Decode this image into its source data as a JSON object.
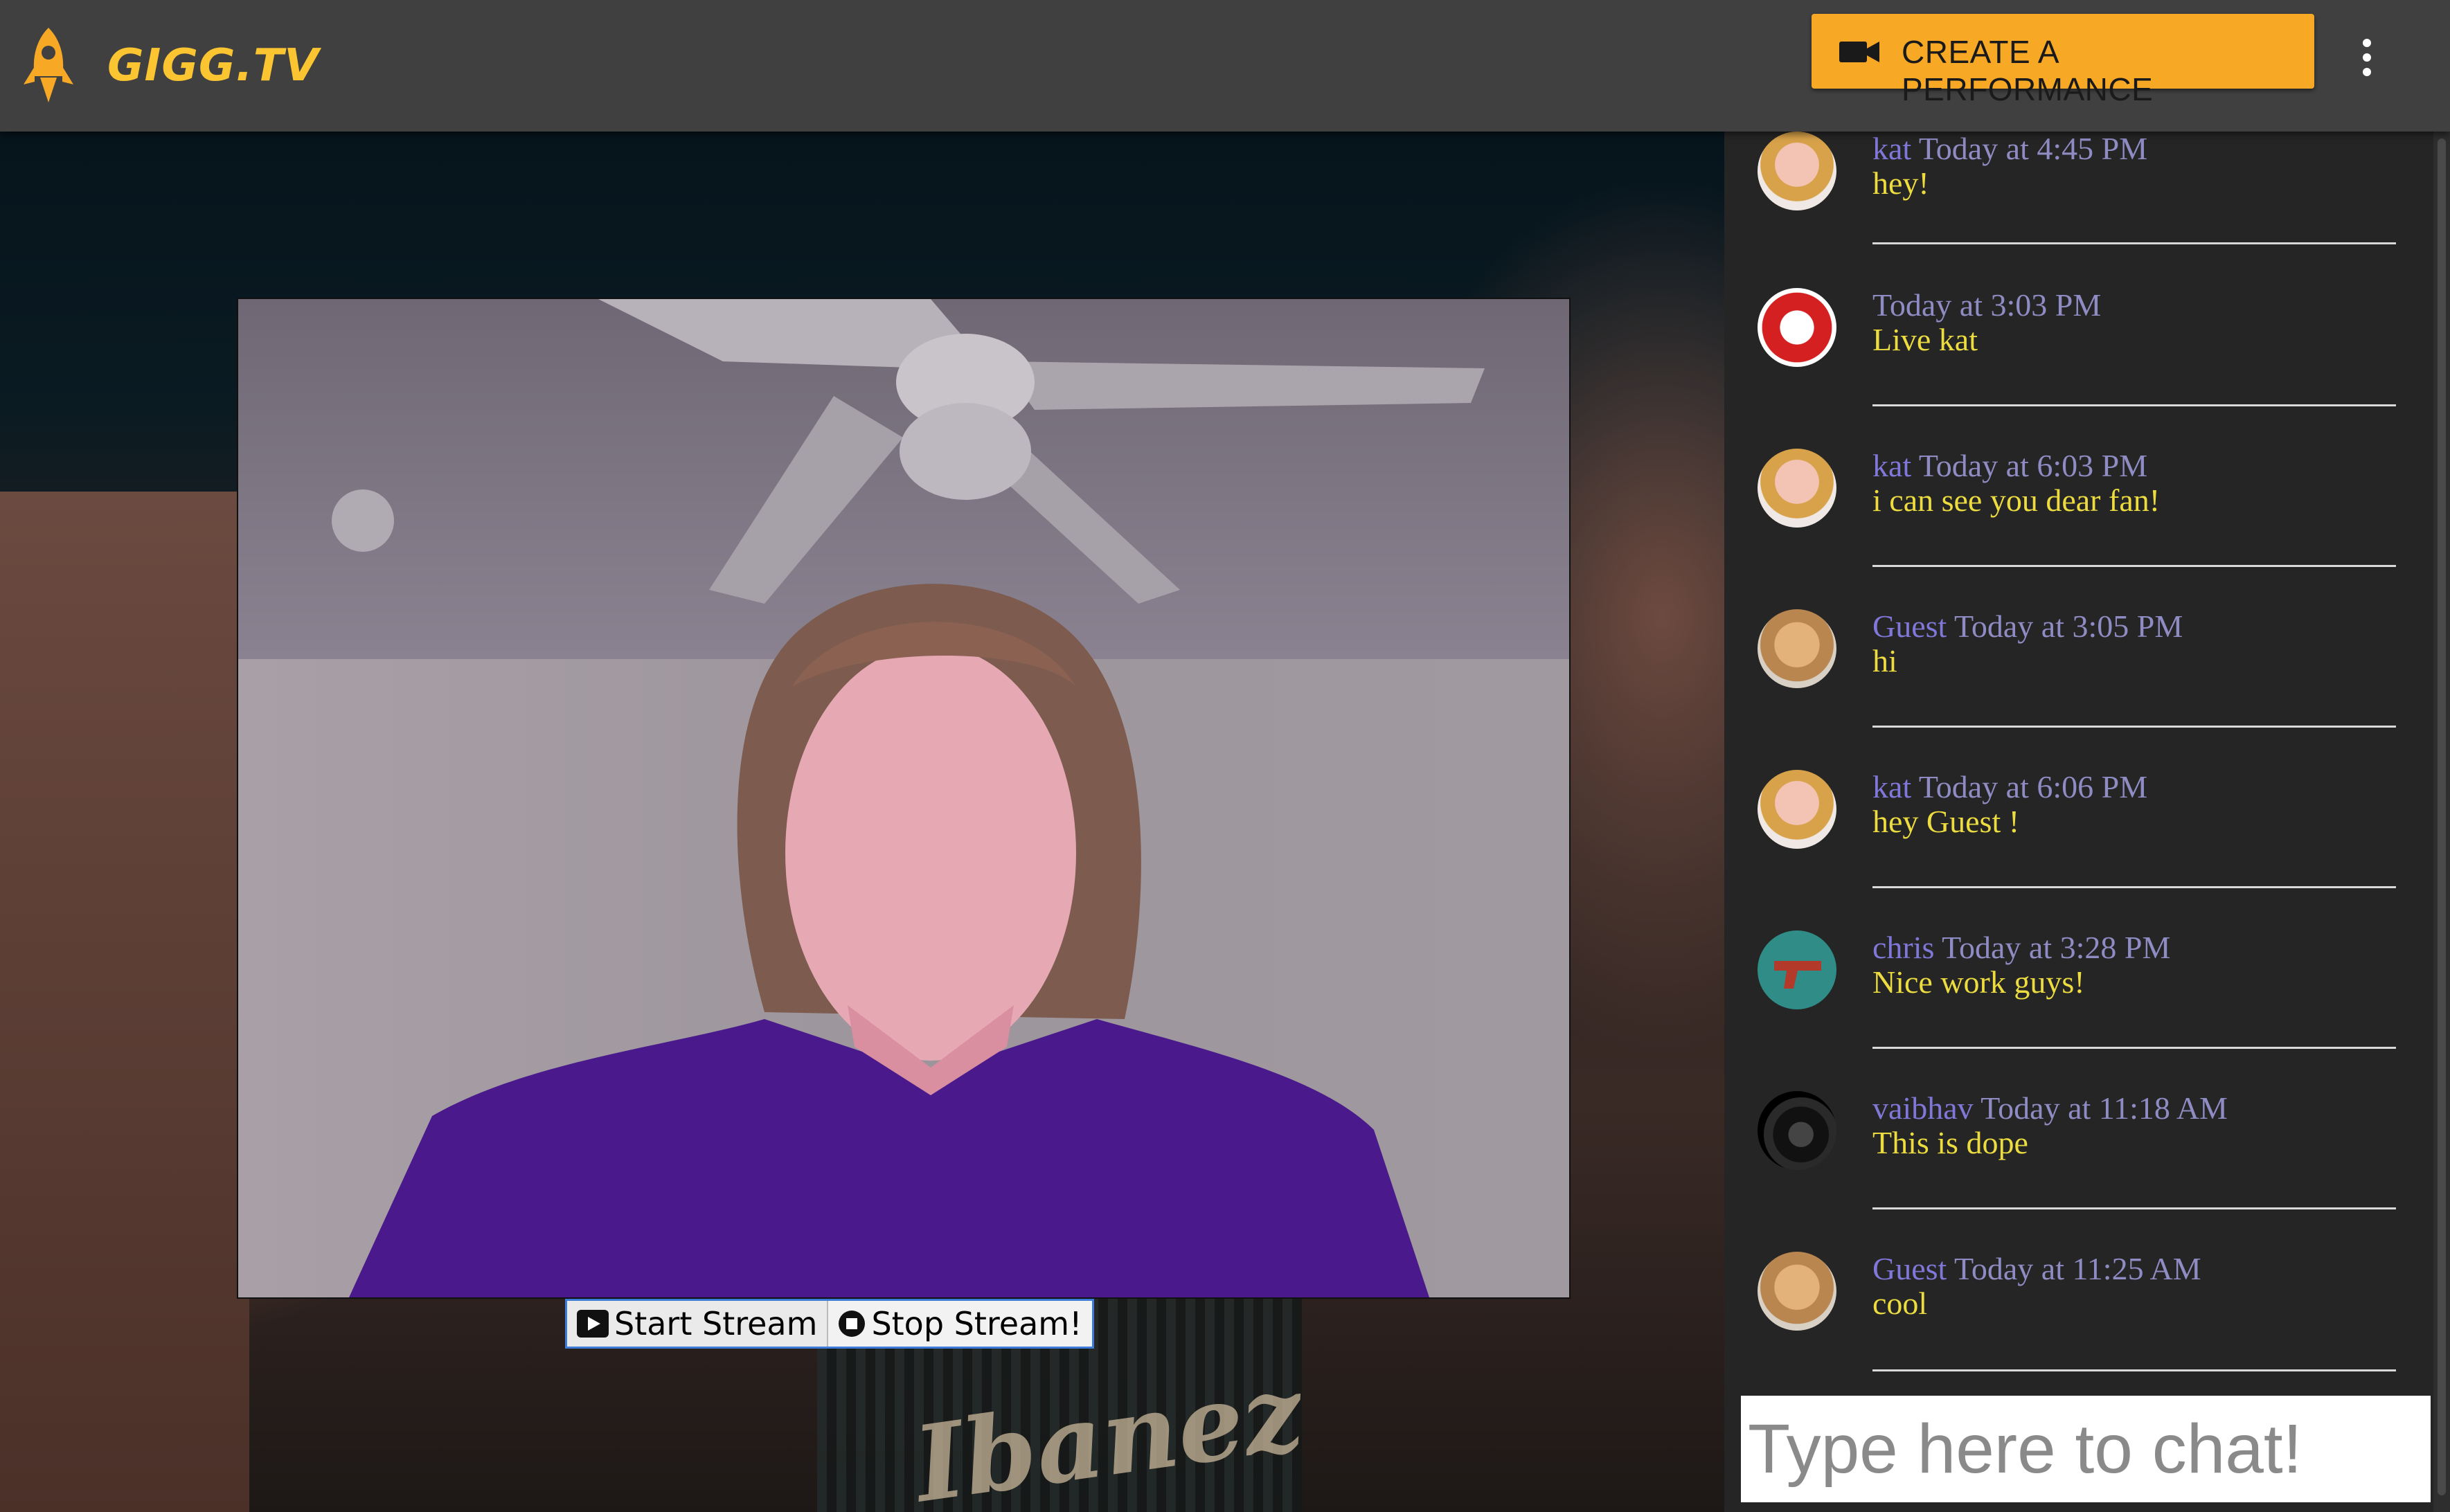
{
  "app": {
    "brand": "GIGG.TV",
    "logo_icon": "rocket-icon",
    "brand_color": "#fbc531"
  },
  "header": {
    "create_label": "CREATE A PERFORMANCE",
    "create_icon": "video-camera-icon",
    "create_color": "#f7a825",
    "more_icon": "more-vertical-icon"
  },
  "stream": {
    "start_label": "Start Stream",
    "start_icon": "play-icon",
    "stop_label": "Stop Stream!",
    "stop_icon": "stop-icon"
  },
  "chat": {
    "input_placeholder": "Type here to chat!",
    "messages": [
      {
        "user": "kat",
        "time": "Today at 4:45 PM",
        "text": "hey!",
        "avatar": "kat-avatar"
      },
      {
        "user": "",
        "time": "Today at 3:03 PM",
        "text": "Live kat",
        "avatar": "red-portrait-avatar"
      },
      {
        "user": "kat",
        "time": "Today at 6:03 PM",
        "text": "i can see you dear fan!",
        "avatar": "kat-avatar"
      },
      {
        "user": "Guest",
        "time": "Today at 3:05 PM",
        "text": "hi",
        "avatar": "puppy-avatar"
      },
      {
        "user": "kat",
        "time": "Today at 6:06 PM",
        "text": "hey Guest !",
        "avatar": "kat-avatar"
      },
      {
        "user": "chris",
        "time": "Today at 3:28 PM",
        "text": "Nice work guys!",
        "avatar": "gun-avatar"
      },
      {
        "user": "vaibhav",
        "time": "Today at 11:18 AM",
        "text": "This is dope",
        "avatar": "tornado-avatar"
      },
      {
        "user": "Guest",
        "time": "Today at 11:25 AM",
        "text": "cool",
        "avatar": "puppy-avatar"
      }
    ],
    "username_color": "#8078d8",
    "text_color": "#ecdc40"
  },
  "background": {
    "amp_brand": "Ibanez"
  }
}
